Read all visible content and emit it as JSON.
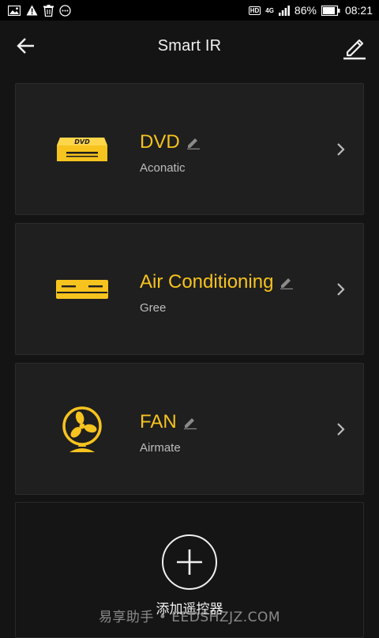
{
  "status_bar": {
    "icons": [
      "image-icon",
      "warning-icon",
      "trash-icon",
      "chat-icon"
    ],
    "hd": "HD",
    "network": "4G",
    "battery_percent": "86%",
    "time": "08:21"
  },
  "header": {
    "title": "Smart IR",
    "back_icon": "back-arrow-icon",
    "edit_icon": "edit-icon"
  },
  "devices": [
    {
      "name": "DVD",
      "brand": "Aconatic",
      "icon": "dvd-player-icon",
      "dvd_logo": "DVD"
    },
    {
      "name": "Air Conditioning",
      "brand": "Gree",
      "icon": "air-conditioner-icon"
    },
    {
      "name": "FAN",
      "brand": "Airmate",
      "icon": "fan-icon"
    }
  ],
  "add_remote": {
    "label": "添加遥控器",
    "icon": "plus-icon"
  },
  "watermark": "易享助手 • EEDSHZJZ.COM",
  "colors": {
    "accent": "#f7c31e",
    "background": "#141414",
    "card": "#1f1f1f"
  }
}
